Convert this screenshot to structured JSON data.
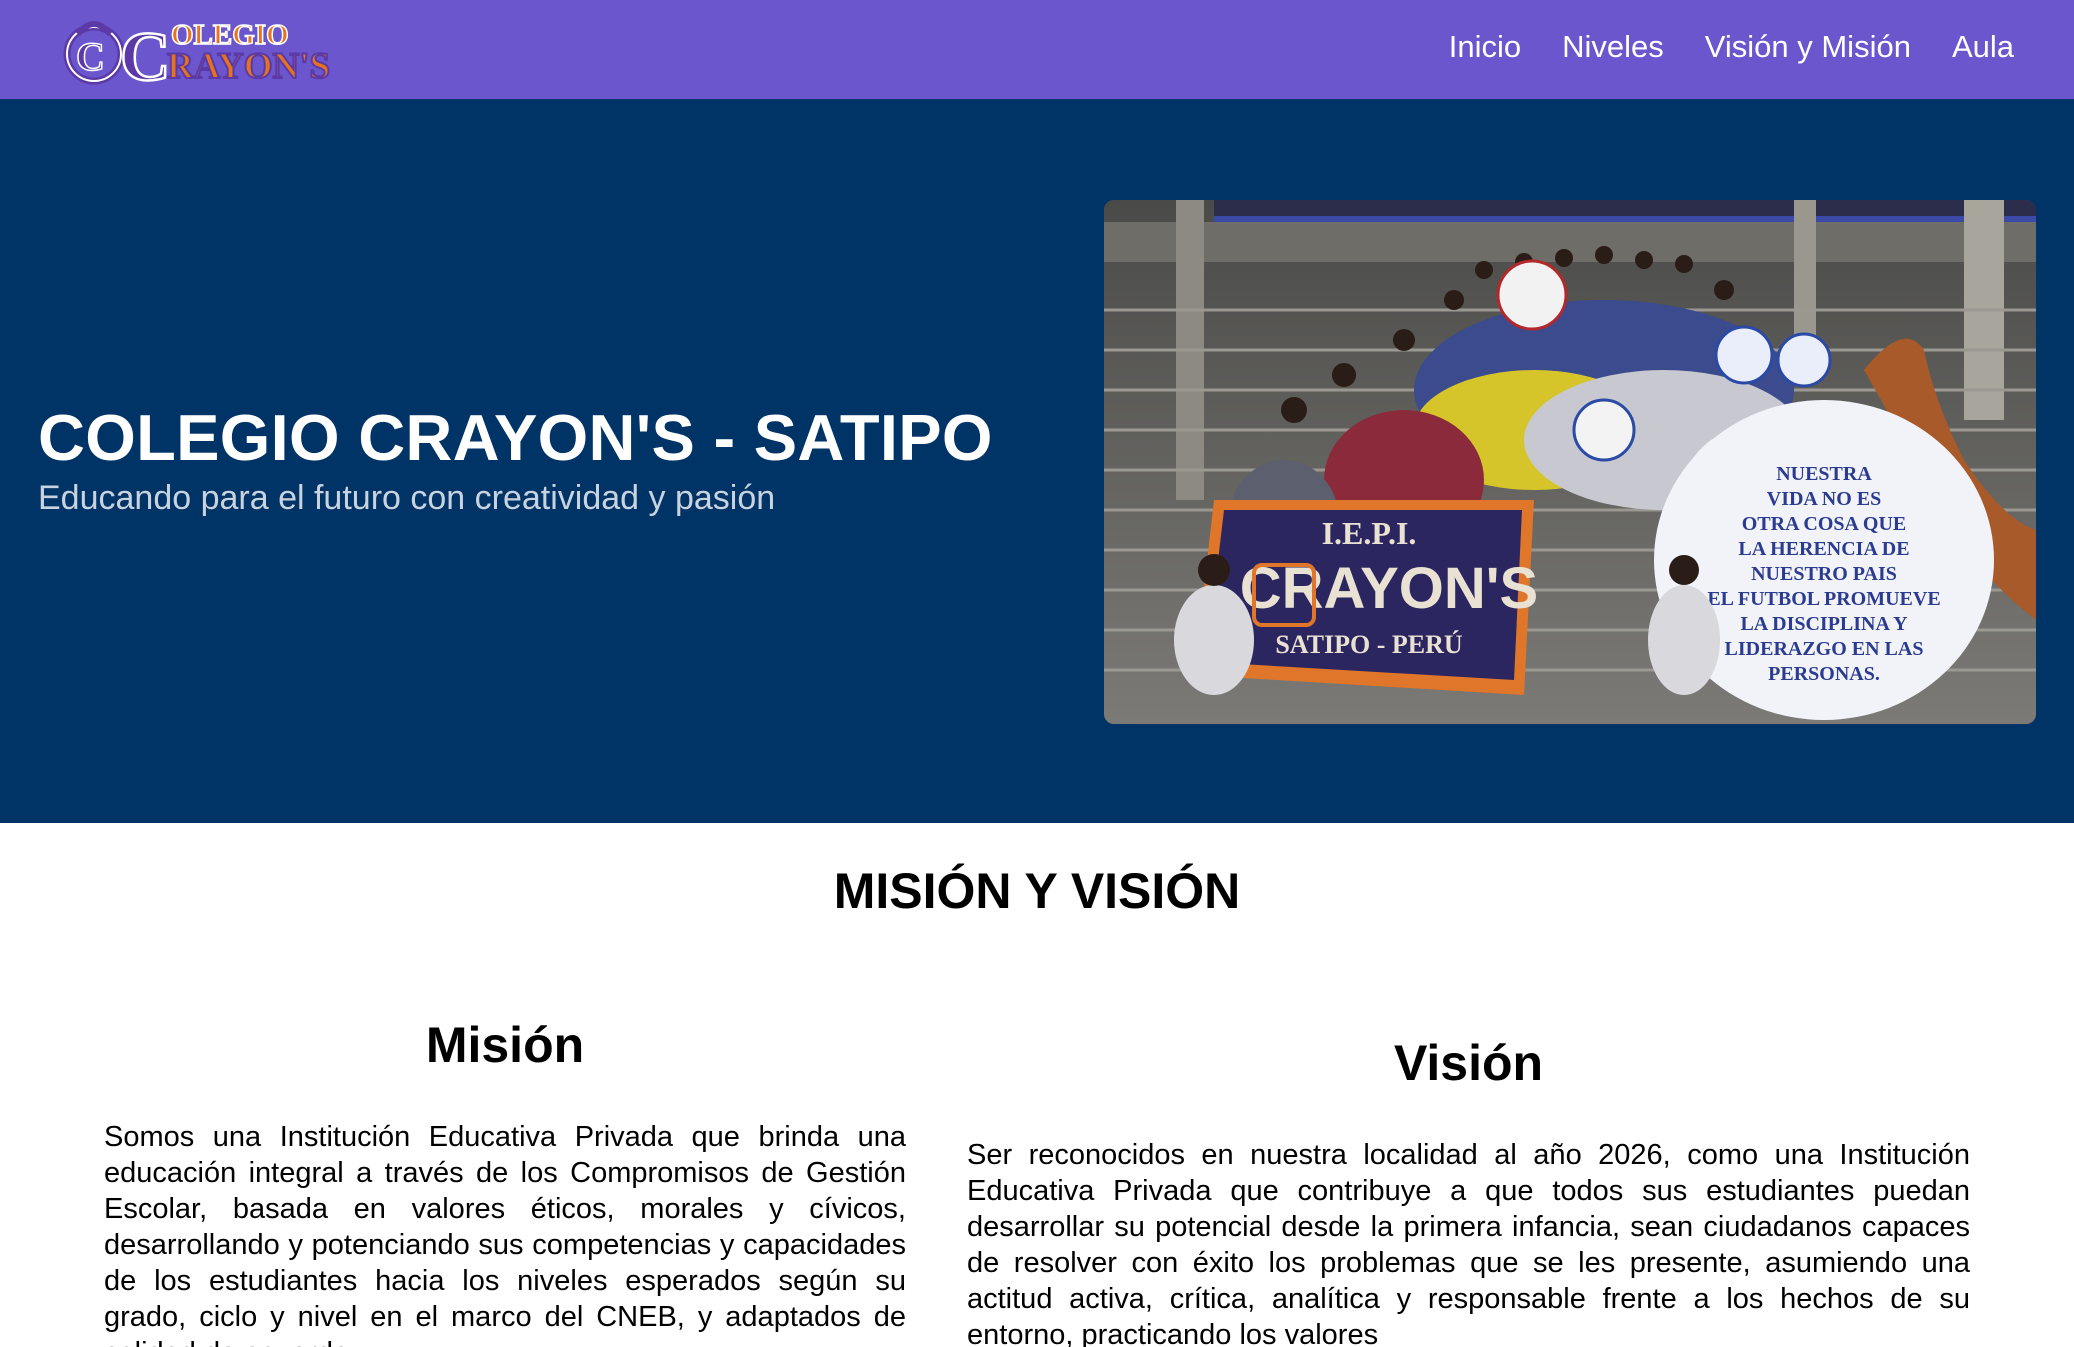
{
  "navbar": {
    "logo_text_top": "OLEGIO",
    "logo_text_main": "RAYON'S",
    "logo_letters": "CC",
    "links": [
      "Inicio",
      "Niveles",
      "Visión y Misión",
      "Aula"
    ]
  },
  "hero": {
    "title": "COLEGIO CRAYON'S - SATIPO",
    "subtitle": "Educando para el futuro con creatividad y pasión",
    "photo": {
      "banner_line1": "I.E.P.I.",
      "banner_line2": "CRAYON'S",
      "banner_line3": "SATIPO - PERÚ",
      "sign_text": "NUESTRA VIDA NO ES OTRA COSA QUE LA HERENCIA DE NUESTRO PAIS. EL FUTBOL PROMUEVE LA DISCIPLINA Y LIDERAZGO EN LAS PERSONAS."
    }
  },
  "mission_vision": {
    "title": "MISIÓN Y VISIÓN",
    "mission": {
      "heading": "Misión",
      "text": "Somos una Institución Educativa Privada que brinda una educación integral a través de los Compromisos de Gestión Escolar, basada en valores éticos, morales y cívicos, desarrollando y potenciando sus competencias y capacidades de los estudiantes hacia los niveles esperados según su grado, ciclo y nivel en el marco del CNEB, y adaptados de calidad de acuerdo"
    },
    "vision": {
      "heading": "Visión",
      "text": "Ser reconocidos en nuestra localidad al año 2026, como una Institución Educativa Privada que contribuye a que todos sus estudiantes puedan desarrollar su potencial desde la primera infancia, sean ciudadanos capaces de resolver con éxito los problemas que se les presente, asumiendo una actitud activa, crítica, analítica y responsable frente a los hechos de su entorno, practicando los valores"
    }
  },
  "colors": {
    "navbar": "#6b56cd",
    "hero": "#003366",
    "logo_orange": "#e8731a",
    "logo_purple": "#5b3aa8"
  }
}
